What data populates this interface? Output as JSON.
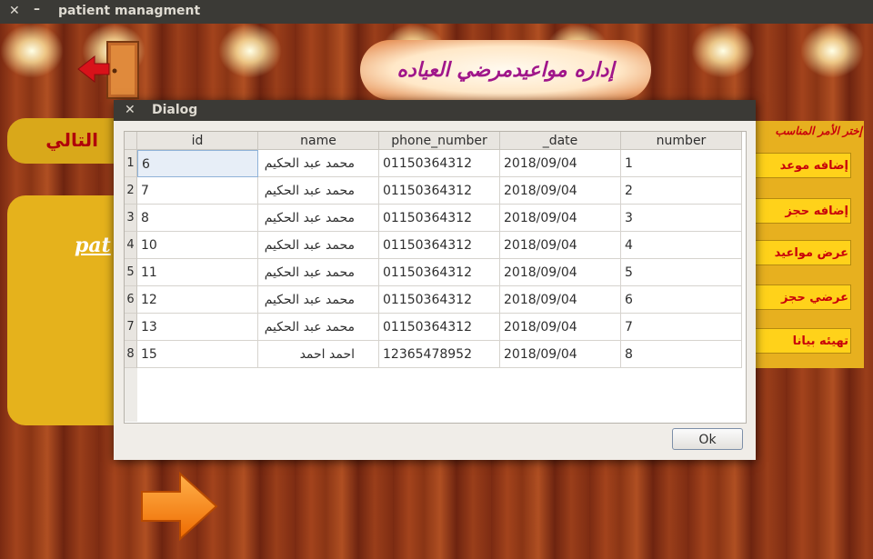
{
  "window": {
    "title": "patient managment",
    "close_glyph": "✕",
    "minimize_glyph": "–"
  },
  "background": {
    "banner_text": "إداره مواعيدمرضي العياده",
    "left_strip_text": "التالي",
    "left_panel_text": "pat",
    "right_hint": "إختر الأمر المناسب",
    "menu_buttons": [
      "إضافه موعد",
      "إضافه حجز",
      "عرض مواعيد",
      "عرضي حجز",
      "تهيئه بيانا"
    ]
  },
  "dialog": {
    "title": "Dialog",
    "ok_label": "Ok",
    "columns": [
      "id",
      "name",
      "phone_number",
      "_date",
      "number"
    ],
    "rows": [
      {
        "row": "1",
        "id": "6",
        "name": "محمد عبد الحكيم",
        "phone": "01150364312",
        "date": "2018/09/04",
        "number": "1"
      },
      {
        "row": "2",
        "id": "7",
        "name": "محمد عبد الحكيم",
        "phone": "01150364312",
        "date": "2018/09/04",
        "number": "2"
      },
      {
        "row": "3",
        "id": "8",
        "name": "محمد عبد الحكيم",
        "phone": "01150364312",
        "date": "2018/09/04",
        "number": "3"
      },
      {
        "row": "4",
        "id": "10",
        "name": "محمد عبد الحكيم",
        "phone": "01150364312",
        "date": "2018/09/04",
        "number": "4"
      },
      {
        "row": "5",
        "id": "11",
        "name": "محمد عبد الحكيم",
        "phone": "01150364312",
        "date": "2018/09/04",
        "number": "5"
      },
      {
        "row": "6",
        "id": "12",
        "name": "محمد عبد الحكيم",
        "phone": "01150364312",
        "date": "2018/09/04",
        "number": "6"
      },
      {
        "row": "7",
        "id": "13",
        "name": "محمد عبد الحكيم",
        "phone": "01150364312",
        "date": "2018/09/04",
        "number": "7"
      },
      {
        "row": "8",
        "id": "15",
        "name": "احمد احمد",
        "phone": "12365478952",
        "date": "2018/09/04",
        "number": "8"
      }
    ]
  },
  "icons": {
    "door": "door-exit-icon",
    "arrow": "next-arrow-icon"
  }
}
